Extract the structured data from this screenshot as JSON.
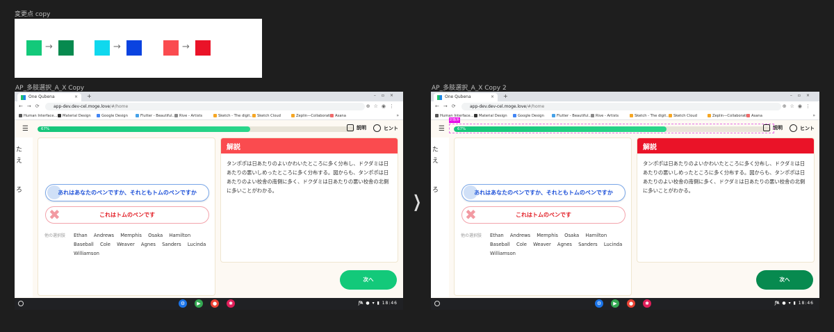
{
  "notes": {
    "title": "変更点 copy",
    "pairs": [
      {
        "from": "#13c97a",
        "to": "#078a4f",
        "arrow": "→"
      },
      {
        "from": "#0fd8ee",
        "to": "#0a43e0",
        "arrow": "→"
      },
      {
        "from": "#fa4b4f",
        "to": "#ea1328",
        "arrow": "→"
      }
    ]
  },
  "frames": [
    {
      "title": "AP_多肢選択_A_X Copy",
      "accent_explain": "#fa4b4f",
      "accent_next": "#13c97a",
      "tag": ""
    },
    {
      "title": "AP_多肢選択_A_X Copy 2",
      "accent_explain": "#ea1328",
      "accent_next": "#078a4f",
      "tag": "対象外"
    }
  ],
  "browser": {
    "tab_title": "One Qubena",
    "tab_close": "×",
    "new_tab": "+",
    "url_host": "app-dev.dev-cel.moge.love",
    "url_path": "/#/home",
    "bookmarks": [
      "Human Interface...",
      "Material Design",
      "Google Design",
      "Flutter - Beautiful...",
      "Rive - Artists",
      "Sketch - The digit...",
      "Sketch Cloud",
      "Zeplin—Collaborati...",
      "Asana"
    ],
    "bookmark_colors": [
      "#555",
      "#333",
      "#4285f4",
      "#45a1e8",
      "#888",
      "#f6a623",
      "#f6a623",
      "#f5a623",
      "#f06a6a"
    ],
    "more": "»"
  },
  "app": {
    "progress": 0.67,
    "progress_label": "67%",
    "explain_btn": "説明",
    "hint_btn": "ヒント",
    "left_chars": [
      "た",
      "え",
      "ろ"
    ],
    "choice1": "あれはあなたのペンですか、それともトムのペンですか",
    "choice2": "これはトムのペンです",
    "others_label": "他の選択肢",
    "others": "Ethan Andrews Memphis Osaka Hamilton Baseball Cole Weaver Agnes Sanders Lucinda Williamson",
    "explain_title": "解説",
    "explain_text": "タンポポは日あたりのよいかわいたところに多く分布し、ドクダミは日あたりの悪いしめったところに多く分布する。図からも、タンポポは日あたりのよい校舎の南側に多く、ドクダミは日あたりの悪い校舎の北側に多いことがわかる。",
    "next": "次へ"
  },
  "shelf": {
    "lang": "JA",
    "time": "18:46",
    "apps": [
      {
        "icon": "settings-icon",
        "color": "#1a73e8",
        "glyph": "⚙"
      },
      {
        "icon": "play-store-icon",
        "color": "#34a853",
        "glyph": "▶"
      },
      {
        "icon": "chrome-icon",
        "color": "#ea4335",
        "glyph": "●"
      },
      {
        "icon": "slack-icon",
        "color": "#e01e5a",
        "glyph": "✱"
      }
    ]
  }
}
